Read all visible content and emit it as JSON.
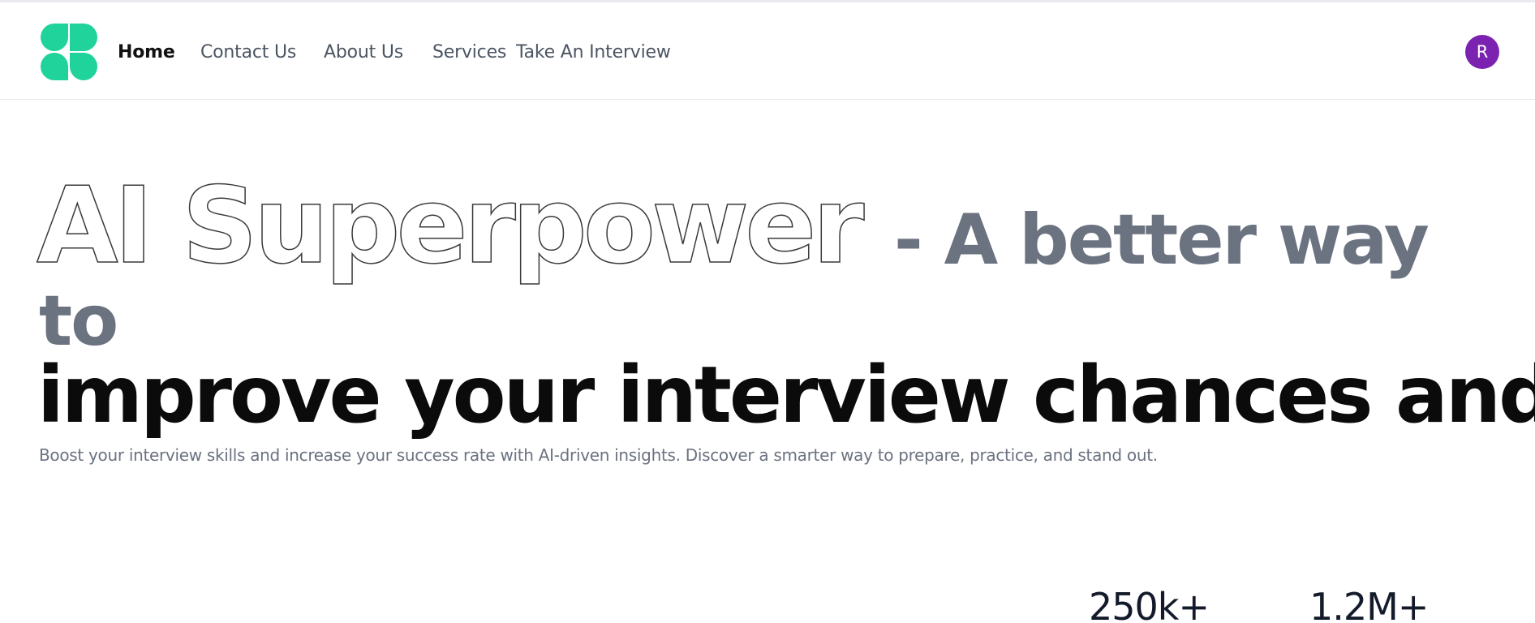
{
  "nav": {
    "items": [
      {
        "label": "Home",
        "active": true
      },
      {
        "label": "Contact Us",
        "active": false
      },
      {
        "label": "About Us",
        "active": false
      },
      {
        "label": "Services",
        "active": false
      },
      {
        "label": "Take An Interview",
        "active": false
      }
    ],
    "avatar_initial": "R"
  },
  "hero": {
    "outline_text": "AI Superpower",
    "gray_text_line1": "- A better way",
    "gray_text_line2": "to",
    "black_text": "improve your interview chances and skills",
    "subtitle": "Boost your interview skills and increase your success rate with AI-driven insights. Discover a smarter way to prepare, practice, and stand out."
  },
  "stats": [
    {
      "value": "250k+"
    },
    {
      "value": "1.2M+"
    }
  ],
  "colors": {
    "brand_green": "#1fd39a",
    "avatar_purple": "#7b22b1",
    "muted_gray": "#6b7280",
    "text_dark": "#0b0b0b",
    "nav_border": "#e7e9ec"
  }
}
